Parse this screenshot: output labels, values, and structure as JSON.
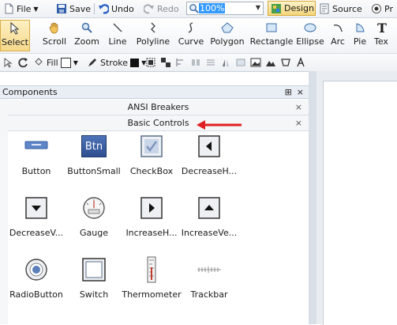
{
  "toolbar_top": {
    "file": "File",
    "save": "Save",
    "undo": "Undo",
    "redo": "Redo",
    "zoom_value": "100%",
    "design": "Design",
    "source": "Source",
    "preview": "Pr"
  },
  "tools": [
    {
      "label": "Select",
      "icon": "select-arrow-icon"
    },
    {
      "label": "Scroll",
      "icon": "hand-icon"
    },
    {
      "label": "Zoom",
      "icon": "magnifier-icon"
    },
    {
      "label": "Line",
      "icon": "line-icon"
    },
    {
      "label": "Polyline",
      "icon": "polyline-icon"
    },
    {
      "label": "Curve",
      "icon": "curve-icon"
    },
    {
      "label": "Polygon",
      "icon": "polygon-icon"
    },
    {
      "label": "Rectangle",
      "icon": "rectangle-icon"
    },
    {
      "label": "Ellipse",
      "icon": "ellipse-icon"
    },
    {
      "label": "Arc",
      "icon": "arc-icon"
    },
    {
      "label": "Pie",
      "icon": "pie-icon"
    },
    {
      "label": "Tex",
      "icon": "text-icon"
    }
  ],
  "format_bar": {
    "fill": "Fill",
    "stroke": "Stroke"
  },
  "panel": {
    "title": "Components",
    "pin": "⊞",
    "close": "×"
  },
  "groups": [
    {
      "title": "ANSI Breakers",
      "close": "×"
    },
    {
      "title": "Basic Controls",
      "close": "×"
    }
  ],
  "components": [
    {
      "label": "Button"
    },
    {
      "label": "ButtonSmall",
      "icon_text": "Btn"
    },
    {
      "label": "CheckBox"
    },
    {
      "label": "DecreaseH..."
    },
    {
      "label": "DecreaseV..."
    },
    {
      "label": "Gauge"
    },
    {
      "label": "IncreaseH..."
    },
    {
      "label": "IncreaseVe..."
    },
    {
      "label": "RadioButton"
    },
    {
      "label": "Switch"
    },
    {
      "label": "Thermometer"
    },
    {
      "label": "Trackbar"
    }
  ],
  "colors": {
    "accent": "#3399ff",
    "annotation_arrow": "#e02020",
    "active_tool": "#f6d98b"
  }
}
